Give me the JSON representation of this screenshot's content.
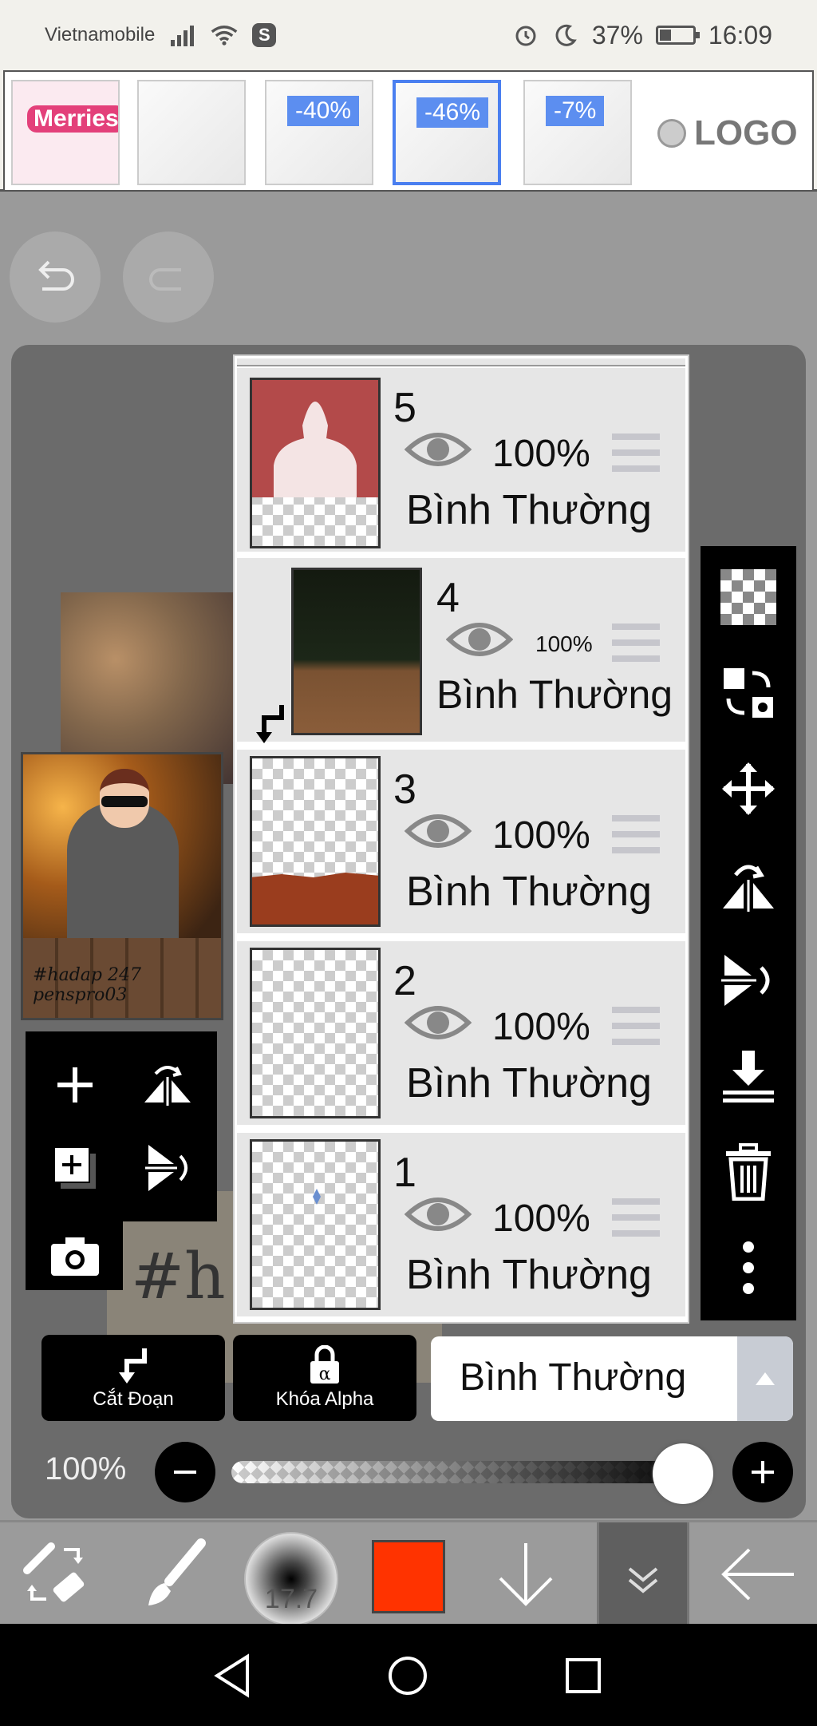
{
  "status_bar": {
    "carrier": "Vietnamobile",
    "battery": "37%",
    "time": "16:09",
    "icons": [
      "signal-icon",
      "wifi-icon",
      "s-app-icon",
      "alarm-icon",
      "moon-icon",
      "battery-icon"
    ]
  },
  "ad": {
    "product_brand": "Merries",
    "discounts": [
      "-40%",
      "-46%",
      "-7%"
    ],
    "logo_text": "LOGO"
  },
  "layers": [
    {
      "number": "5",
      "opacity": "100%",
      "blend": "Bình Thường"
    },
    {
      "number": "4",
      "opacity": "100%",
      "blend": "Bình Thường"
    },
    {
      "number": "3",
      "opacity": "100%",
      "blend": "Bình Thường"
    },
    {
      "number": "2",
      "opacity": "100%",
      "blend": "Bình Thường"
    },
    {
      "number": "1",
      "opacity": "100%",
      "blend": "Bình Thường"
    }
  ],
  "preview": {
    "signature": "#hadap 247\npenspro03",
    "canvas_text": "#h"
  },
  "actions": {
    "clipping_label": "Cắt Đoạn",
    "alpha_lock_label": "Khóa Alpha",
    "blend_mode": "Bình Thường"
  },
  "opacity": {
    "label": "100%",
    "value": 1.0
  },
  "toolbar": {
    "brush_size": "17.7",
    "color": "#ff3300"
  }
}
